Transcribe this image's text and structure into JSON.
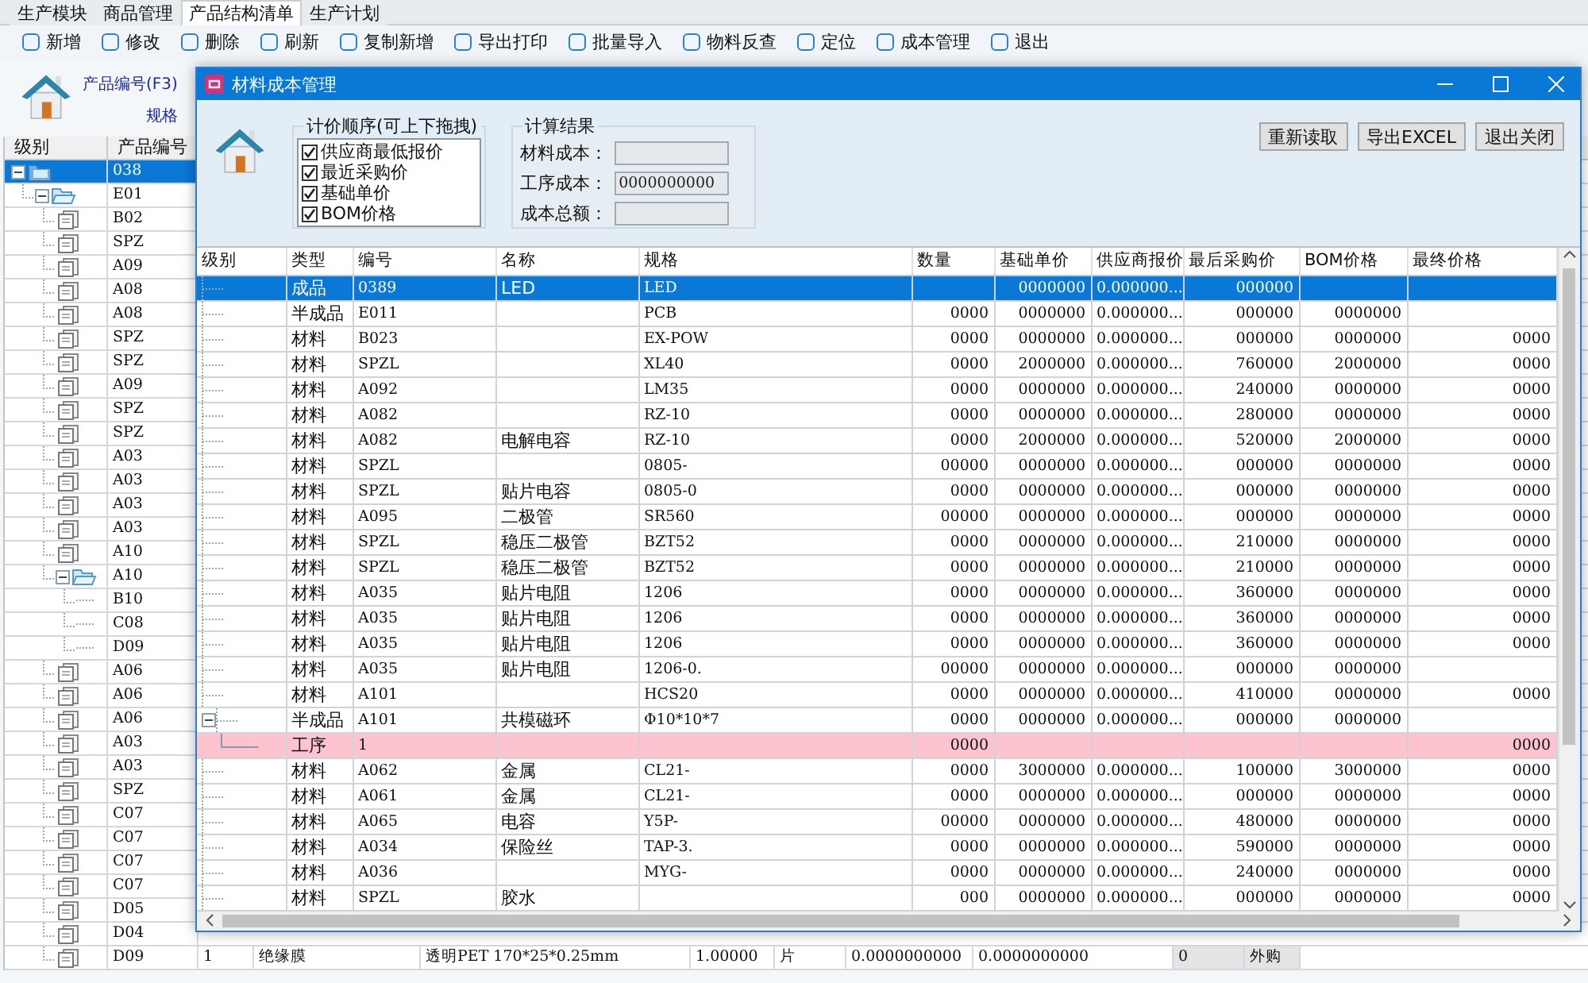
{
  "tabs": [
    {
      "label": "生产模块",
      "selected": false
    },
    {
      "label": "商品管理",
      "selected": false
    },
    {
      "label": "产品结构清单",
      "selected": true
    },
    {
      "label": "生产计划",
      "selected": false
    }
  ],
  "toolbar": [
    "新增",
    "修改",
    "删除",
    "刷新",
    "复制新增",
    "导出打印",
    "批量导入",
    "物料反查",
    "定位",
    "成本管理",
    "退出"
  ],
  "header": {
    "product_code_label": "产品编号(F3)",
    "spec_label": "规格"
  },
  "tree": {
    "columns": [
      "级别",
      "产品编号"
    ],
    "nodes": [
      {
        "code": "038",
        "kind": "root",
        "selected": true,
        "expanded": true,
        "children": [
          {
            "code": "E01",
            "kind": "folder",
            "selected": false,
            "expanded": true,
            "children": [
              {
                "code": "B02",
                "kind": "item",
                "selected": false
              },
              {
                "code": "SPZ",
                "kind": "item",
                "selected": false
              },
              {
                "code": "A09",
                "kind": "item",
                "selected": false
              },
              {
                "code": "A08",
                "kind": "item",
                "selected": false
              },
              {
                "code": "A08",
                "kind": "item",
                "selected": false
              },
              {
                "code": "SPZ",
                "kind": "item",
                "selected": false
              },
              {
                "code": "SPZ",
                "kind": "item",
                "selected": false
              },
              {
                "code": "A09",
                "kind": "item",
                "selected": false
              },
              {
                "code": "SPZ",
                "kind": "item",
                "selected": false
              },
              {
                "code": "SPZ",
                "kind": "item",
                "selected": false
              },
              {
                "code": "A03",
                "kind": "item",
                "selected": false
              },
              {
                "code": "A03",
                "kind": "item",
                "selected": false
              },
              {
                "code": "A03",
                "kind": "item",
                "selected": false
              },
              {
                "code": "A03",
                "kind": "item",
                "selected": false
              },
              {
                "code": "A10",
                "kind": "item",
                "selected": false
              },
              {
                "code": "A10",
                "kind": "folder",
                "selected": false,
                "expanded": true,
                "children": [
                  {
                    "code": "B10",
                    "kind": "plain",
                    "selected": false
                  },
                  {
                    "code": "C08",
                    "kind": "plain",
                    "selected": false
                  },
                  {
                    "code": "D09",
                    "kind": "plain",
                    "selected": false
                  }
                ]
              },
              {
                "code": "A06",
                "kind": "item",
                "selected": false
              },
              {
                "code": "A06",
                "kind": "item",
                "selected": false
              },
              {
                "code": "A06",
                "kind": "item",
                "selected": false
              },
              {
                "code": "A03",
                "kind": "item",
                "selected": false
              },
              {
                "code": "A03",
                "kind": "item",
                "selected": false
              },
              {
                "code": "SPZ",
                "kind": "item",
                "selected": false
              },
              {
                "code": "C07",
                "kind": "item",
                "selected": false
              },
              {
                "code": "C07",
                "kind": "item",
                "selected": false
              },
              {
                "code": "C07",
                "kind": "item",
                "selected": false
              },
              {
                "code": "C07",
                "kind": "item",
                "selected": false
              },
              {
                "code": "D05",
                "kind": "item",
                "selected": false
              },
              {
                "code": "D04",
                "kind": "item",
                "selected": false
              },
              {
                "code": "D09",
                "kind": "item",
                "selected": false,
                "cells": [
                  "1",
                  "绝缘膜",
                  "透明PET 170*25*0.25mm",
                  "1.00000",
                  "片",
                  "0.0000000000",
                  "0.0000000000",
                  "0",
                  "外购"
                ]
              }
            ]
          }
        ]
      }
    ]
  },
  "dialog": {
    "title": "材料成本管理",
    "pricing_order": {
      "title": "计价顺序(可上下拖拽)",
      "items": [
        {
          "label": "供应商最低报价",
          "checked": true
        },
        {
          "label": "最近采购价",
          "checked": true
        },
        {
          "label": "基础单价",
          "checked": true
        },
        {
          "label": "BOM价格",
          "checked": true
        }
      ]
    },
    "results": {
      "title": "计算结果",
      "fields": [
        {
          "label": "材料成本："
        },
        {
          "label": "工序成本：",
          "value": "0000000000"
        },
        {
          "label": "成本总额："
        }
      ]
    },
    "buttons": [
      "重新读取",
      "导出EXCEL",
      "退出关闭"
    ],
    "table": {
      "columns": [
        "级别",
        "类型",
        "编号",
        "名称",
        "规格",
        "数量",
        "基础单价",
        "供应商报价",
        "最后采购价",
        "BOM价格",
        "最终价格"
      ],
      "rows": [
        {
          "type": "成品",
          "code": "0389",
          "name": "LED",
          "spec": "LED",
          "base_price": "0000000",
          "supplier_price": "0.000000...",
          "last_price": "000000",
          "kind": "item",
          "selected": true
        },
        {
          "type": "半成品",
          "code": "E011",
          "spec": "PCB",
          "quantity": "0000",
          "base_price": "0000000",
          "supplier_price": "0.000000...",
          "last_price": "000000",
          "bom_price": "0000000",
          "kind": "item",
          "selected": false
        },
        {
          "type": "材料",
          "code": "B023",
          "spec": "EX-POW",
          "quantity": "0000",
          "base_price": "0000000",
          "supplier_price": "0.000000...",
          "last_price": "000000",
          "bom_price": "0000000",
          "final_price": "0000",
          "kind": "item",
          "selected": false
        },
        {
          "type": "材料",
          "code": "SPZL",
          "spec": "XL40",
          "quantity": "0000",
          "base_price": "2000000",
          "supplier_price": "0.000000...",
          "last_price": "760000",
          "bom_price": "2000000",
          "final_price": "0000",
          "kind": "item",
          "selected": false
        },
        {
          "type": "材料",
          "code": "A092",
          "spec": "LM35",
          "quantity": "0000",
          "base_price": "0000000",
          "supplier_price": "0.000000...",
          "last_price": "240000",
          "bom_price": "0000000",
          "final_price": "0000",
          "kind": "item",
          "selected": false
        },
        {
          "type": "材料",
          "code": "A082",
          "spec": "RZ-10",
          "quantity": "0000",
          "base_price": "0000000",
          "supplier_price": "0.000000...",
          "last_price": "280000",
          "bom_price": "0000000",
          "final_price": "0000",
          "kind": "item",
          "selected": false
        },
        {
          "type": "材料",
          "code": "A082",
          "name": "电解电容",
          "spec": "RZ-10",
          "quantity": "0000",
          "base_price": "2000000",
          "supplier_price": "0.000000...",
          "last_price": "520000",
          "bom_price": "2000000",
          "final_price": "0000",
          "kind": "item",
          "selected": false
        },
        {
          "type": "材料",
          "code": "SPZL",
          "spec": "0805-",
          "quantity": "00000",
          "base_price": "0000000",
          "supplier_price": "0.000000...",
          "last_price": "000000",
          "bom_price": "0000000",
          "final_price": "0000",
          "kind": "item",
          "selected": false
        },
        {
          "type": "材料",
          "code": "SPZL",
          "name": "贴片电容",
          "spec": "0805-0",
          "quantity": "0000",
          "base_price": "0000000",
          "supplier_price": "0.000000...",
          "last_price": "000000",
          "bom_price": "0000000",
          "final_price": "0000",
          "kind": "item",
          "selected": false
        },
        {
          "type": "材料",
          "code": "A095",
          "name": "二极管",
          "spec": "SR560",
          "quantity": "00000",
          "base_price": "0000000",
          "supplier_price": "0.000000...",
          "last_price": "000000",
          "bom_price": "0000000",
          "final_price": "0000",
          "kind": "item",
          "selected": false
        },
        {
          "type": "材料",
          "code": "SPZL",
          "name": "稳压二极管",
          "spec": "BZT52",
          "quantity": "0000",
          "base_price": "0000000",
          "supplier_price": "0.000000...",
          "last_price": "210000",
          "bom_price": "0000000",
          "final_price": "0000",
          "kind": "item",
          "selected": false
        },
        {
          "type": "材料",
          "code": "SPZL",
          "name": "稳压二极管",
          "spec": "BZT52",
          "quantity": "0000",
          "base_price": "0000000",
          "supplier_price": "0.000000...",
          "last_price": "210000",
          "bom_price": "0000000",
          "final_price": "0000",
          "kind": "item",
          "selected": false
        },
        {
          "type": "材料",
          "code": "A035",
          "name": "贴片电阻",
          "spec": "1206",
          "quantity": "0000",
          "base_price": "0000000",
          "supplier_price": "0.000000...",
          "last_price": "360000",
          "bom_price": "0000000",
          "final_price": "0000",
          "kind": "item",
          "selected": false
        },
        {
          "type": "材料",
          "code": "A035",
          "name": "贴片电阻",
          "spec": "1206",
          "quantity": "0000",
          "base_price": "0000000",
          "supplier_price": "0.000000...",
          "last_price": "360000",
          "bom_price": "0000000",
          "final_price": "0000",
          "kind": "item",
          "selected": false
        },
        {
          "type": "材料",
          "code": "A035",
          "name": "贴片电阻",
          "spec": "1206",
          "quantity": "0000",
          "base_price": "0000000",
          "supplier_price": "0.000000...",
          "last_price": "360000",
          "bom_price": "0000000",
          "final_price": "0000",
          "kind": "item",
          "selected": false
        },
        {
          "type": "材料",
          "code": "A035",
          "name": "贴片电阻",
          "spec": "1206-0.",
          "quantity": "00000",
          "base_price": "0000000",
          "supplier_price": "0.000000...",
          "last_price": "000000",
          "bom_price": "0000000",
          "kind": "item",
          "selected": false
        },
        {
          "type": "材料",
          "code": "A101",
          "spec": "HCS20",
          "quantity": "0000",
          "base_price": "0000000",
          "supplier_price": "0.000000...",
          "last_price": "410000",
          "bom_price": "0000000",
          "final_price": "0000",
          "kind": "item",
          "selected": false
        },
        {
          "type": "半成品",
          "code": "A101",
          "name": "共模磁环",
          "spec": "Φ10*10*7",
          "quantity": "0000",
          "base_price": "0000000",
          "supplier_price": "0.000000...",
          "last_price": "000000",
          "bom_price": "0000000",
          "kind": "item",
          "selected": false,
          "expanded": true,
          "children": [
            {
              "type": "工序",
              "code": "1",
              "quantity": "0000",
              "final_price": "0000",
              "kind": "process",
              "selected": false
            }
          ]
        },
        {
          "type": "材料",
          "code": "A062",
          "name": "金属",
          "spec": "CL21-",
          "quantity": "0000",
          "base_price": "3000000",
          "supplier_price": "0.000000...",
          "last_price": "100000",
          "bom_price": "3000000",
          "final_price": "0000",
          "kind": "item",
          "selected": false
        },
        {
          "type": "材料",
          "code": "A061",
          "name": "金属",
          "spec": "CL21-",
          "quantity": "0000",
          "base_price": "0000000",
          "supplier_price": "0.000000...",
          "last_price": "000000",
          "bom_price": "0000000",
          "final_price": "0000",
          "kind": "item",
          "selected": false
        },
        {
          "type": "材料",
          "code": "A065",
          "name": "电容",
          "spec": "Y5P-",
          "quantity": "00000",
          "base_price": "0000000",
          "supplier_price": "0.000000...",
          "last_price": "480000",
          "bom_price": "0000000",
          "final_price": "0000",
          "kind": "item",
          "selected": false
        },
        {
          "type": "材料",
          "code": "A034",
          "name": "保险丝",
          "spec": "TAP-3.",
          "quantity": "0000",
          "base_price": "0000000",
          "supplier_price": "0.000000...",
          "last_price": "590000",
          "bom_price": "0000000",
          "final_price": "0000",
          "kind": "item",
          "selected": false
        },
        {
          "type": "材料",
          "code": "A036",
          "spec": "MYG-",
          "quantity": "0000",
          "base_price": "0000000",
          "supplier_price": "0.000000...",
          "last_price": "240000",
          "bom_price": "0000000",
          "final_price": "0000",
          "kind": "item",
          "selected": false
        },
        {
          "type": "材料",
          "code": "SPZL",
          "name": "胶水",
          "quantity": "000",
          "base_price": "0000000",
          "supplier_price": "0.000000...",
          "last_price": "000000",
          "bom_price": "0000000",
          "final_price": "0000",
          "kind": "item",
          "selected": false
        }
      ]
    }
  }
}
